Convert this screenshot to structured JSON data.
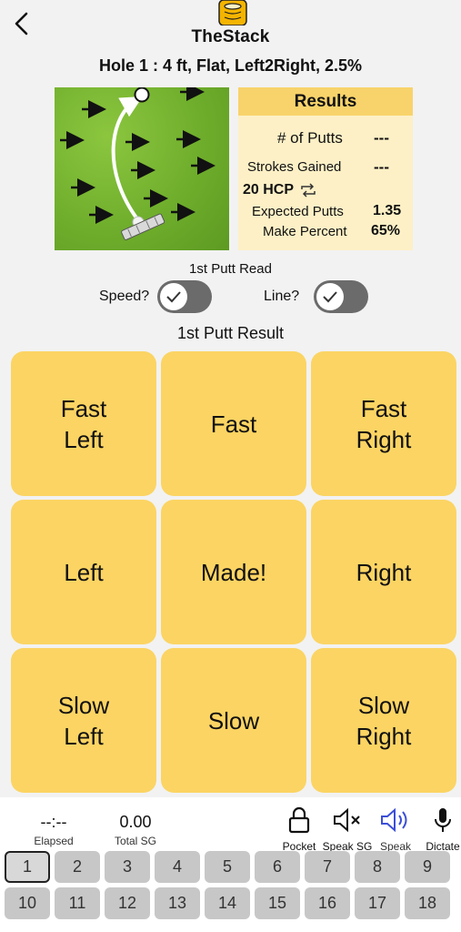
{
  "app": {
    "title": "TheStack"
  },
  "hole": {
    "title": "Hole 1 :  4 ft, Flat, Left2Right, 2.5%"
  },
  "results": {
    "header": "Results",
    "putts_label": "# of Putts",
    "putts_value": "---",
    "sg_label": "Strokes Gained",
    "sg_value": "---",
    "hcp_label": "20 HCP",
    "expected_label": "Expected Putts",
    "expected_value": "1.35",
    "make_label": "Make Percent",
    "make_value": "65%"
  },
  "read": {
    "title": "1st Putt Read",
    "speed_label": "Speed?",
    "line_label": "Line?"
  },
  "result_title": "1st Putt Result",
  "grid": [
    {
      "label": "Fast\nLeft"
    },
    {
      "label": "Fast"
    },
    {
      "label": "Fast\nRight"
    },
    {
      "label": "Left"
    },
    {
      "label": "Made!"
    },
    {
      "label": "Right"
    },
    {
      "label": "Slow\nLeft"
    },
    {
      "label": "Slow"
    },
    {
      "label": "Slow\nRight"
    }
  ],
  "stats": {
    "elapsed_value": "--:--",
    "elapsed_label": "Elapsed",
    "total_sg_value": "0.00",
    "total_sg_label": "Total SG"
  },
  "tools": {
    "pocket": "Pocket",
    "speak_sg": "Speak SG",
    "speak": "Speak",
    "dictate": "Dictate"
  },
  "holes": [
    "1",
    "2",
    "3",
    "4",
    "5",
    "6",
    "7",
    "8",
    "9",
    "10",
    "11",
    "12",
    "13",
    "14",
    "15",
    "16",
    "17",
    "18"
  ],
  "colors": {
    "accent": "#fbd463",
    "results_bg": "#fdf0c6",
    "speak_active": "#3b4fd8"
  },
  "icons": [
    "back-chevron-icon",
    "stack-logo-icon",
    "refresh-icon",
    "check-icon",
    "lock-icon",
    "speaker-mute-icon",
    "speaker-icon",
    "microphone-icon"
  ]
}
